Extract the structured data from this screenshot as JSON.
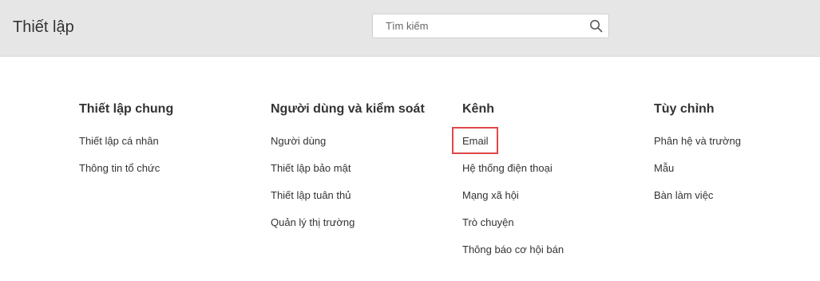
{
  "header": {
    "title": "Thiết lập",
    "search_placeholder": "Tìm kiếm",
    "search_value": ""
  },
  "columns": [
    {
      "title": "Thiết lập chung",
      "items": [
        "Thiết lập cá nhân",
        "Thông tin tổ chức"
      ]
    },
    {
      "title": "Người dùng và kiểm soát",
      "items": [
        "Người dùng",
        "Thiết lập bảo mật",
        "Thiết lập tuân thủ",
        "Quản lý thị trường"
      ]
    },
    {
      "title": "Kênh",
      "items": [
        "Email",
        "Hệ thống điện thoại",
        "Mạng xã hội",
        "Trò chuyện",
        "Thông báo cơ hội bán"
      ]
    },
    {
      "title": "Tùy chỉnh",
      "items": [
        "Phân hệ và trường",
        "Mẫu",
        "Bàn làm việc"
      ]
    }
  ],
  "highlight": {
    "item": "Email",
    "color": "#e0484a"
  },
  "colors": {
    "header_bg": "#e6e6e6",
    "text": "#333333"
  }
}
